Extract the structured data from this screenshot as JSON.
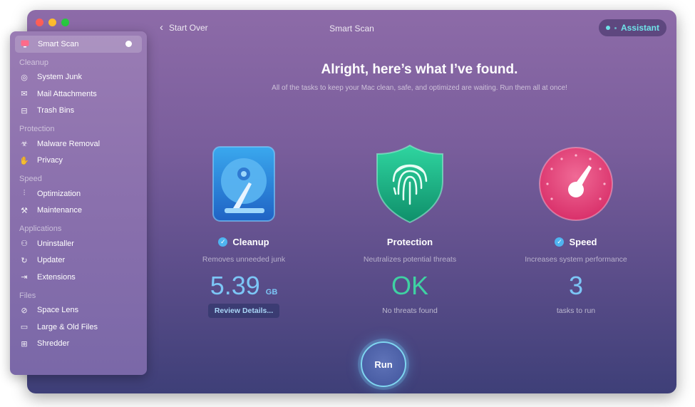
{
  "window": {
    "title": "Smart Scan",
    "back_label": "Start Over",
    "assistant_label": "Assistant"
  },
  "sidebar": {
    "active": {
      "label": "Smart Scan",
      "icon": "monitor-scan-icon"
    },
    "sections": [
      {
        "header": "Cleanup",
        "items": [
          {
            "label": "System Junk",
            "icon": "system-junk-icon"
          },
          {
            "label": "Mail Attachments",
            "icon": "mail-icon"
          },
          {
            "label": "Trash Bins",
            "icon": "trash-icon"
          }
        ]
      },
      {
        "header": "Protection",
        "items": [
          {
            "label": "Malware Removal",
            "icon": "biohazard-icon"
          },
          {
            "label": "Privacy",
            "icon": "hand-icon"
          }
        ]
      },
      {
        "header": "Speed",
        "items": [
          {
            "label": "Optimization",
            "icon": "sliders-icon"
          },
          {
            "label": "Maintenance",
            "icon": "wrench-icon"
          }
        ]
      },
      {
        "header": "Applications",
        "items": [
          {
            "label": "Uninstaller",
            "icon": "uninstaller-icon"
          },
          {
            "label": "Updater",
            "icon": "updater-icon"
          },
          {
            "label": "Extensions",
            "icon": "extensions-icon"
          }
        ]
      },
      {
        "header": "Files",
        "items": [
          {
            "label": "Space Lens",
            "icon": "lens-icon"
          },
          {
            "label": "Large & Old Files",
            "icon": "folder-icon"
          },
          {
            "label": "Shredder",
            "icon": "shredder-icon"
          }
        ]
      }
    ]
  },
  "main": {
    "headline": "Alright, here’s what I’ve found.",
    "subline": "All of the tasks to keep your Mac clean, safe, and optimized are waiting. Run them all at once!",
    "cards": {
      "cleanup": {
        "title": "Cleanup",
        "desc": "Removes unneeded junk",
        "value": "5.39",
        "unit": "GB",
        "button": "Review Details..."
      },
      "protection": {
        "title": "Protection",
        "desc": "Neutralizes potential threats",
        "value": "OK",
        "sub": "No threats found"
      },
      "speed": {
        "title": "Speed",
        "desc": "Increases system performance",
        "value": "3",
        "sub": "tasks to run"
      }
    },
    "run_label": "Run"
  },
  "colors": {
    "accent": "#7cc6f6",
    "ok": "#3fd1a3",
    "check": "#4fb4f0",
    "assistant": "#6fe3e8"
  }
}
